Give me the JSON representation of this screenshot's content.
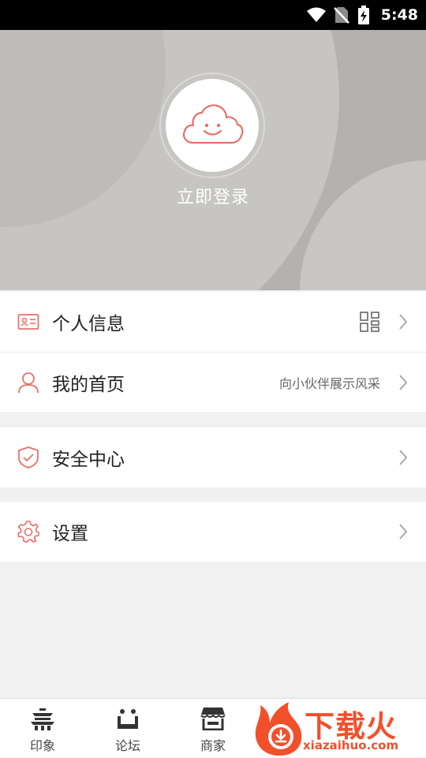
{
  "status_bar": {
    "time": "5:48"
  },
  "header": {
    "login_label": "立即登录"
  },
  "menu": {
    "items": [
      {
        "label": "个人信息",
        "icon": "id-card-icon",
        "trailing": "qr-code-icon"
      },
      {
        "label": "我的首页",
        "icon": "user-icon",
        "subtitle": "向小伙伴展示风采"
      },
      {
        "label": "安全中心",
        "icon": "shield-check-icon"
      },
      {
        "label": "设置",
        "icon": "gear-icon"
      }
    ]
  },
  "tabs": [
    {
      "label": "印象",
      "icon": "gate-icon"
    },
    {
      "label": "论坛",
      "icon": "forum-icon"
    },
    {
      "label": "商家",
      "icon": "store-icon"
    }
  ],
  "watermark": {
    "brand": "下载火",
    "url": "xiazaihuo.com"
  },
  "colors": {
    "accent": "#e8706a",
    "hero_bg": "#b4b1ae",
    "watermark": "#f2502b"
  }
}
